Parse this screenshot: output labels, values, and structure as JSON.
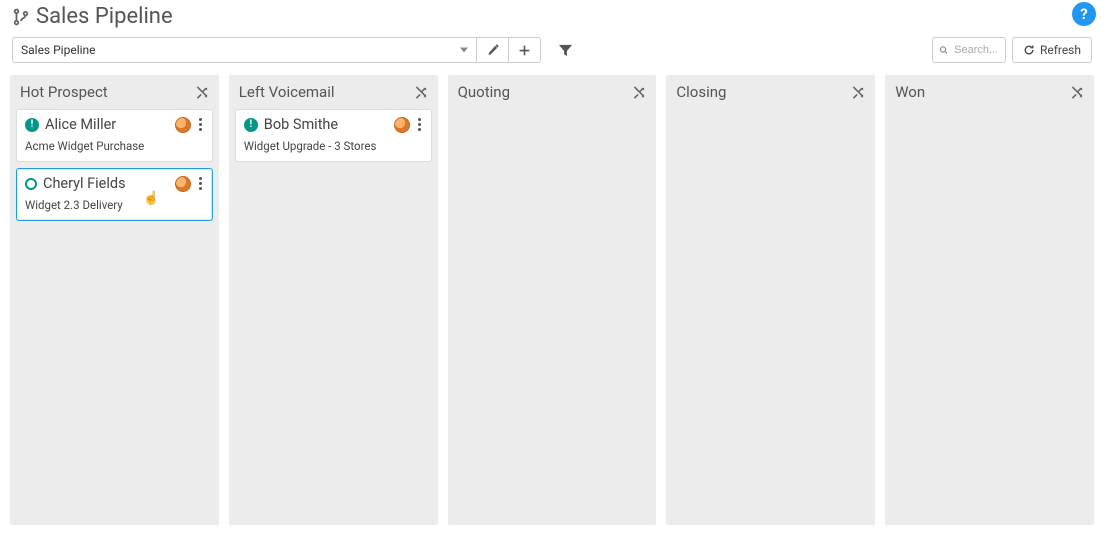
{
  "page_title": "Sales Pipeline",
  "picker_value": "Sales Pipeline",
  "search_placeholder": "Search...",
  "refresh_label": "Refresh",
  "columns": [
    {
      "title": "Hot Prospect",
      "cards": [
        {
          "name": "Alice Miller",
          "sub": "Acme Widget Purchase",
          "status": "alert",
          "hovered": false
        },
        {
          "name": "Cheryl Fields",
          "sub": "Widget 2.3 Delivery",
          "status": "open",
          "hovered": true
        }
      ]
    },
    {
      "title": "Left Voicemail",
      "cards": [
        {
          "name": "Bob Smithe",
          "sub": "Widget Upgrade - 3 Stores",
          "status": "alert",
          "hovered": false
        }
      ]
    },
    {
      "title": "Quoting",
      "cards": []
    },
    {
      "title": "Closing",
      "cards": []
    },
    {
      "title": "Won",
      "cards": []
    }
  ]
}
